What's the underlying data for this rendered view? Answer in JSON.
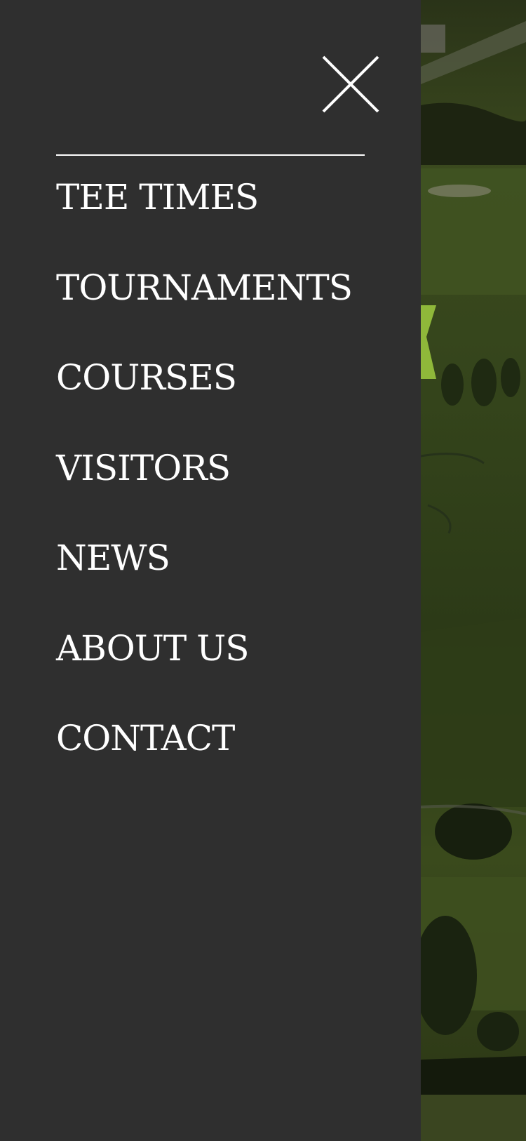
{
  "close_icon": "close-icon",
  "menu": {
    "items": [
      {
        "label": "TEE TIMES"
      },
      {
        "label": "TOURNAMENTS"
      },
      {
        "label": "COURSES"
      },
      {
        "label": "VISITORS"
      },
      {
        "label": "NEWS"
      },
      {
        "label": "ABOUT US"
      },
      {
        "label": "CONTACT"
      }
    ]
  },
  "colors": {
    "drawer_background": "#2f2f2f",
    "text": "#ffffff",
    "accent": "#8fb83a"
  }
}
